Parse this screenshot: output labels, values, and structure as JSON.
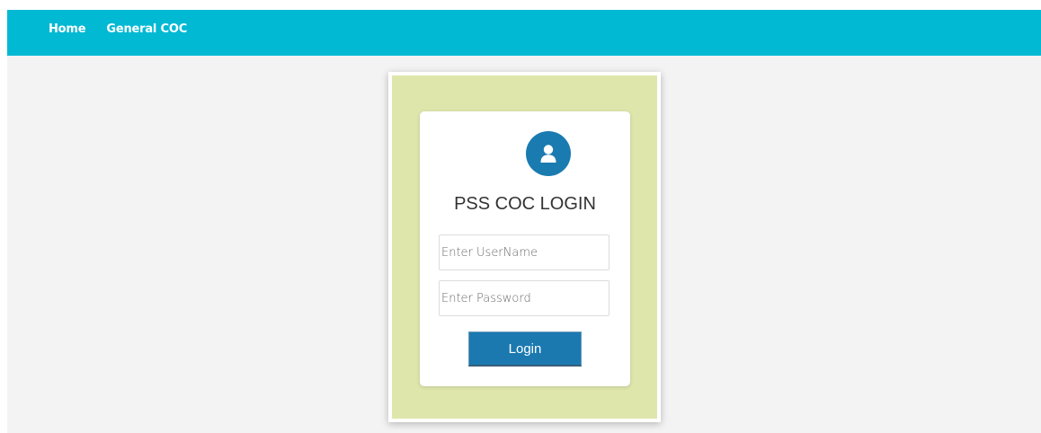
{
  "nav": {
    "home_label": "Home",
    "general_coc_label": "General COC"
  },
  "login": {
    "title": "PSS COC LOGIN",
    "username_placeholder": "Enter UserName",
    "username_value": "",
    "password_placeholder": "Enter Password",
    "password_value": "",
    "button_label": "Login",
    "avatar_icon": "user-icon"
  },
  "colors": {
    "topbar": "#02b9d4",
    "frame": "#dfe6ac",
    "accent": "#1b79b0",
    "background": "#f3f3f3"
  }
}
